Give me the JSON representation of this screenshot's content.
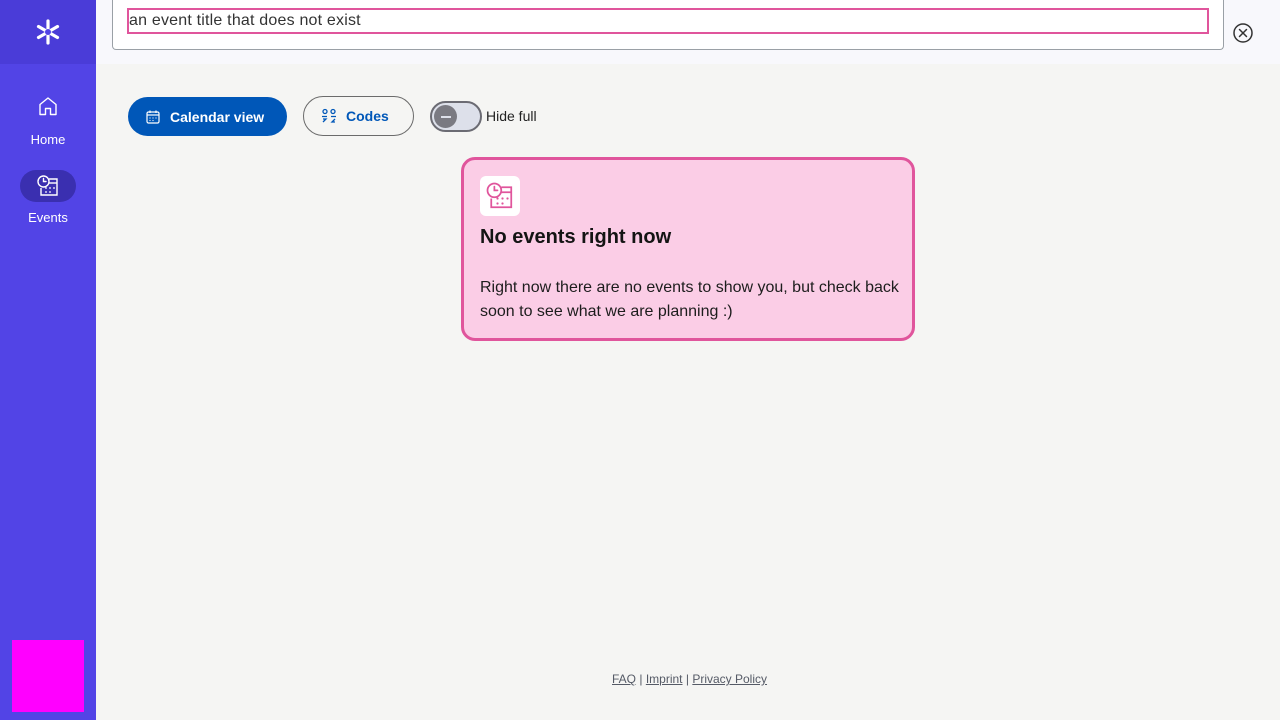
{
  "sidebar": {
    "logo_icon": "asterisk-logo-icon",
    "items": [
      {
        "label": "Home",
        "icon": "home-icon",
        "active": false
      },
      {
        "label": "Events",
        "icon": "events-icon",
        "active": true
      }
    ]
  },
  "search": {
    "value": "an event title that does not exist",
    "clear_icon": "close-circle-icon"
  },
  "toolbar": {
    "calendar_label": "Calendar view",
    "codes_label": "Codes",
    "toggle_label": "Hide full",
    "toggle_on": false
  },
  "empty_state": {
    "title": "No events right now",
    "text": "Right now there are no events to show you, but check back soon to see what we are planning :)"
  },
  "footer": {
    "faq": "FAQ",
    "sep": "|",
    "imprint": "Imprint",
    "privacy": "Privacy Policy"
  },
  "colors": {
    "sidebar": "#5244e6",
    "primary": "#0057b8",
    "accent": "#e0559c",
    "card_bg": "#fbcde6",
    "debug_box": "#ff00ff"
  }
}
